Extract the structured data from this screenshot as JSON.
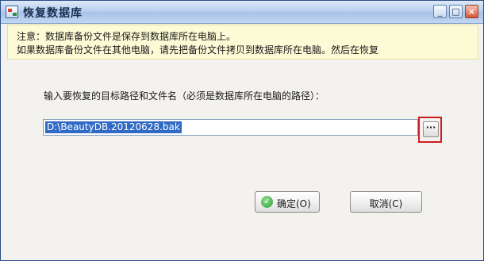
{
  "window": {
    "title": "恢复数据库",
    "app_icon": "database-app-icon",
    "controls": {
      "minimize": "_",
      "maximize": "□",
      "close": "×"
    }
  },
  "notice": {
    "line1": "注意：数据库备份文件是保存到数据库所在电脑上。",
    "line2": "如果数据库备份文件在其他电脑，请先把备份文件拷贝到数据库所在电脑。然后在恢复"
  },
  "form": {
    "prompt": "输入要恢复的目标路径和文件名（必须是数据库所在电脑的路径）：",
    "path_value": "D:\\BeautyDB.20120628.bak",
    "browse_label": "···"
  },
  "buttons": {
    "ok_label": "确定(O)",
    "ok_icon": "check-icon",
    "cancel_label": "取消(C)"
  },
  "colors": {
    "titlebar": "#b9d0ee",
    "notice_bg": "#fdfbd6",
    "selection": "#316ac5",
    "highlight_border": "#d01c1c",
    "ok_icon": "#2f9a3a"
  }
}
